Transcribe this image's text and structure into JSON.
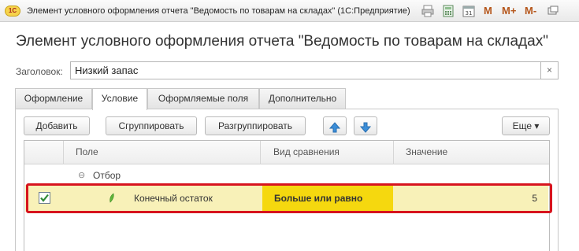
{
  "window": {
    "logo_text": "1С",
    "title": "Элемент условного оформления отчета \"Ведомость по товарам на складах\"  (1С:Предприятие)",
    "buttons": [
      "M",
      "M+",
      "M-"
    ]
  },
  "form": {
    "title": "Элемент условного оформления отчета \"Ведомость по товарам на складах\"",
    "caption_label": "Заголовок:",
    "caption_value": "Низкий запас",
    "clear_glyph": "×"
  },
  "tabs": [
    {
      "label": "Оформление",
      "active": false
    },
    {
      "label": "Условие",
      "active": true
    },
    {
      "label": "Оформляемые поля",
      "active": false
    },
    {
      "label": "Дополнительно",
      "active": false
    }
  ],
  "toolbar": {
    "add": "Добавить",
    "group": "Сгруппировать",
    "ungroup": "Разгруппировать",
    "more": "Еще ▾"
  },
  "table": {
    "columns": [
      "Поле",
      "Вид сравнения",
      "Значение"
    ],
    "group_toggle": "⊖",
    "group_label": "Отбор",
    "row": {
      "checked": true,
      "field": "Конечный остаток",
      "comparison": "Больше или равно",
      "value": "5"
    }
  },
  "colors": {
    "row_highlight": "#f8f1b8",
    "comparison_bg": "#f5d80f",
    "selection_border": "#d7141e",
    "accent_arrow": "#3b8ed9"
  }
}
